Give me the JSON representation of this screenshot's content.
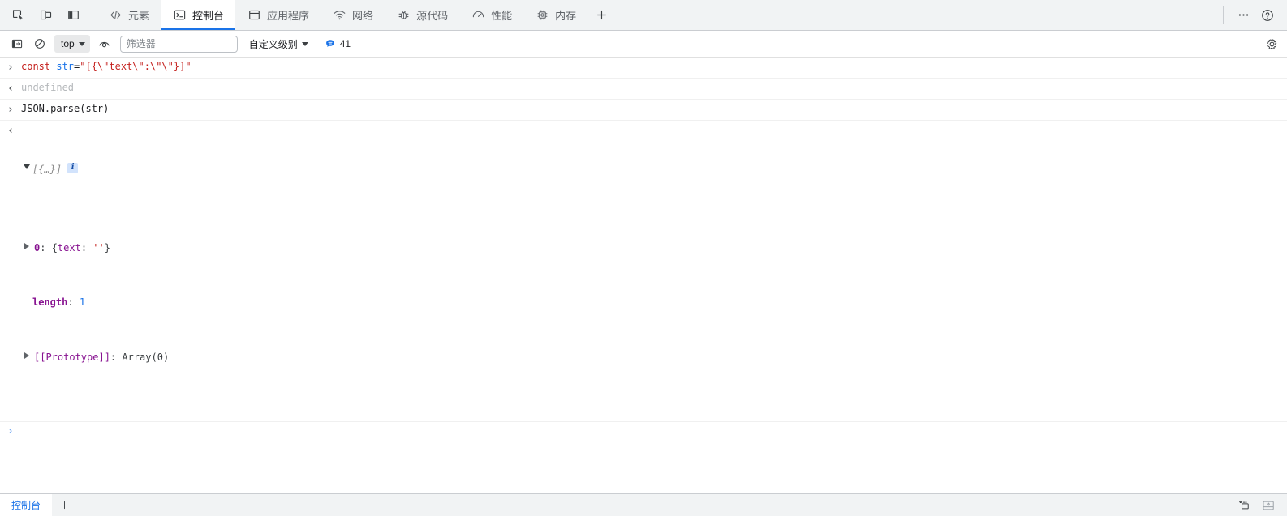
{
  "window": {
    "title": "Chrome DevTools"
  },
  "toolbar_left": {
    "inspect_label": "检查元素",
    "device_label": "设备工具栏",
    "panel_label": "面板"
  },
  "tabs": [
    {
      "id": "elements",
      "label": "元素",
      "icon": "code-icon",
      "active": false
    },
    {
      "id": "console",
      "label": "控制台",
      "icon": "console-icon",
      "active": true
    },
    {
      "id": "application",
      "label": "应用程序",
      "icon": "application-icon",
      "active": false
    },
    {
      "id": "network",
      "label": "网络",
      "icon": "network-icon",
      "active": false
    },
    {
      "id": "sources",
      "label": "源代码",
      "icon": "bug-icon",
      "active": false
    },
    {
      "id": "performance",
      "label": "性能",
      "icon": "performance-icon",
      "active": false
    },
    {
      "id": "memory",
      "label": "内存",
      "icon": "memory-icon",
      "active": false
    }
  ],
  "tabbar_right": {
    "more_label": "更多选项",
    "help_label": "帮助"
  },
  "console_toolbar": {
    "sidebar_toggle_label": "显示控制台边栏",
    "clear_label": "清空控制台",
    "context": "top",
    "eye_label": "实时表达式",
    "filter_placeholder": "筛选器",
    "filter_value": "",
    "level_label": "自定义级别",
    "message_count": "41",
    "settings_label": "设置"
  },
  "console": {
    "messages": [
      {
        "kind": "input",
        "gutter": "›",
        "tokens": [
          {
            "cls": "tok-kw",
            "t": "const "
          },
          {
            "cls": "tok-var",
            "t": "str"
          },
          {
            "cls": "tok-plain",
            "t": "="
          },
          {
            "cls": "tok-str",
            "t": "\"[{\\\"text\\\":\\\"\\\"}]\""
          }
        ]
      },
      {
        "kind": "output-simple",
        "gutter": "‹",
        "text": "undefined"
      },
      {
        "kind": "input",
        "gutter": "›",
        "tokens": [
          {
            "cls": "tok-plain",
            "t": "JSON.parse(str)"
          }
        ]
      },
      {
        "kind": "output-object",
        "gutter": "‹",
        "preview": "[{…}]",
        "badge": "i",
        "expanded": true,
        "children": [
          {
            "expandable": true,
            "key": "0",
            "sep": ": ",
            "value_parts": [
              {
                "cls": "tok-gray",
                "t": "{"
              },
              {
                "cls": "tok-key",
                "t": "text"
              },
              {
                "cls": "tok-gray",
                "t": ": "
              },
              {
                "cls": "tok-str",
                "t": "''"
              },
              {
                "cls": "tok-gray",
                "t": "}"
              }
            ]
          },
          {
            "expandable": false,
            "key": "length",
            "sep": ": ",
            "value_parts": [
              {
                "cls": "tok-num",
                "t": "1"
              }
            ]
          },
          {
            "expandable": true,
            "key": "[[Prototype]]",
            "key_cls": "tok-proto",
            "sep": ": ",
            "value_parts": [
              {
                "cls": "tok-gray",
                "t": "Array(0)"
              }
            ]
          }
        ]
      }
    ],
    "prompt": {
      "gutter": "›",
      "value": ""
    }
  },
  "drawer": {
    "tab_label": "控制台",
    "add_label": "更多工具",
    "reload_label": "重新加载",
    "dock_label": "停靠位置"
  }
}
